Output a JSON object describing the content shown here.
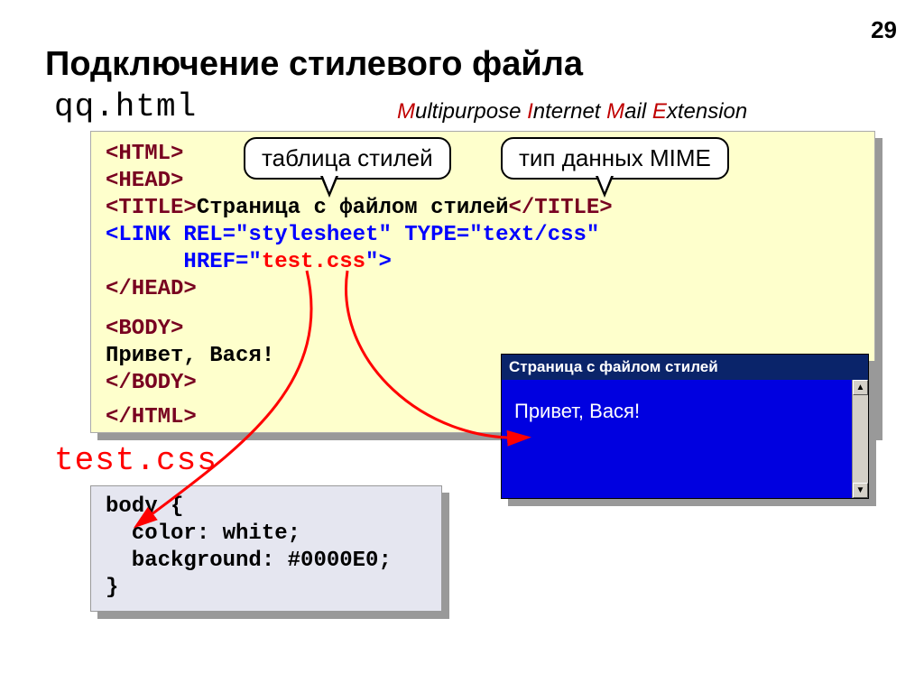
{
  "page_number": "29",
  "main_title": "Подключение стилевого файла",
  "filename_html": "qq.html",
  "mime": {
    "m": "M",
    "m_rest": "ultipurpose ",
    "i": "I",
    "i_rest": "nternet ",
    "ma": "M",
    "ma_rest": "ail ",
    "e": "E",
    "e_rest": "xtension"
  },
  "callout1": "таблица стилей",
  "callout2": "тип данных MIME",
  "html_code": {
    "l1": "<HTML>",
    "l2": "<HEAD>",
    "l3a": "<TITLE>",
    "l3b": "Страница с файлом стилей",
    "l3c": "</TITLE>",
    "l4a": "<LINK REL=",
    "l4b": "\"stylesheet\"",
    "l4c": " TYPE=",
    "l4d": "\"text/css\"",
    "l5a": "      HREF=\"",
    "l5b": "test.css",
    "l5c": "\">",
    "l6": "</HEAD>",
    "l7": "<BODY>",
    "l8": "Привет, Вася!",
    "l9": "</BODY>",
    "l10": "</HTML>"
  },
  "filename_css": "test.css",
  "css_code": {
    "l1": "body {",
    "l2": "  color: white;",
    "l3": "  background: #0000E0;",
    "l4": "}"
  },
  "browser": {
    "title": "Страница с файлом стилей",
    "content": "Привет, Вася!",
    "scroll_up": "▲",
    "scroll_down": "▼"
  }
}
